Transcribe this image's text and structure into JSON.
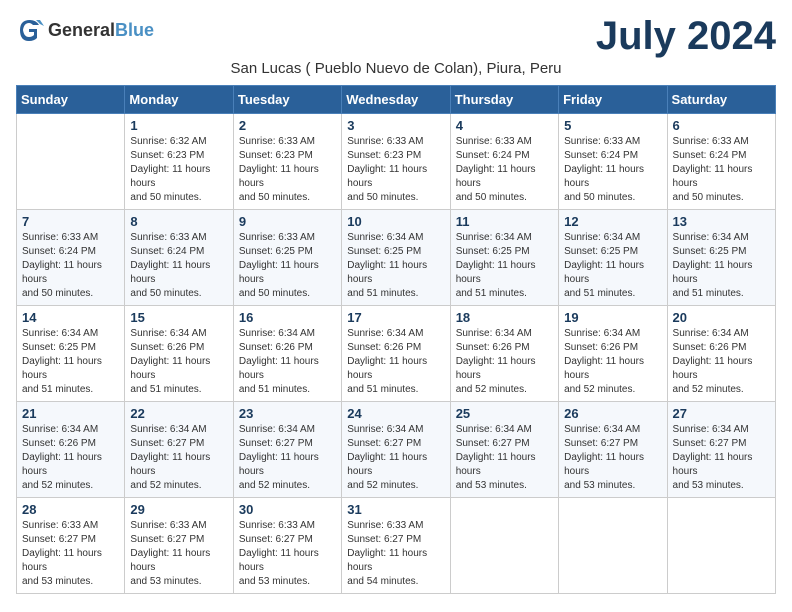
{
  "header": {
    "logo_general": "General",
    "logo_blue": "Blue",
    "month": "July 2024",
    "subtitle": "San Lucas ( Pueblo Nuevo de Colan), Piura, Peru"
  },
  "weekdays": [
    "Sunday",
    "Monday",
    "Tuesday",
    "Wednesday",
    "Thursday",
    "Friday",
    "Saturday"
  ],
  "weeks": [
    [
      {
        "day": "",
        "sunrise": "",
        "sunset": "",
        "daylight": ""
      },
      {
        "day": "1",
        "sunrise": "Sunrise: 6:32 AM",
        "sunset": "Sunset: 6:23 PM",
        "daylight": "Daylight: 11 hours and 50 minutes."
      },
      {
        "day": "2",
        "sunrise": "Sunrise: 6:33 AM",
        "sunset": "Sunset: 6:23 PM",
        "daylight": "Daylight: 11 hours and 50 minutes."
      },
      {
        "day": "3",
        "sunrise": "Sunrise: 6:33 AM",
        "sunset": "Sunset: 6:23 PM",
        "daylight": "Daylight: 11 hours and 50 minutes."
      },
      {
        "day": "4",
        "sunrise": "Sunrise: 6:33 AM",
        "sunset": "Sunset: 6:24 PM",
        "daylight": "Daylight: 11 hours and 50 minutes."
      },
      {
        "day": "5",
        "sunrise": "Sunrise: 6:33 AM",
        "sunset": "Sunset: 6:24 PM",
        "daylight": "Daylight: 11 hours and 50 minutes."
      },
      {
        "day": "6",
        "sunrise": "Sunrise: 6:33 AM",
        "sunset": "Sunset: 6:24 PM",
        "daylight": "Daylight: 11 hours and 50 minutes."
      }
    ],
    [
      {
        "day": "7",
        "sunrise": "Sunrise: 6:33 AM",
        "sunset": "Sunset: 6:24 PM",
        "daylight": "Daylight: 11 hours and 50 minutes."
      },
      {
        "day": "8",
        "sunrise": "Sunrise: 6:33 AM",
        "sunset": "Sunset: 6:24 PM",
        "daylight": "Daylight: 11 hours and 50 minutes."
      },
      {
        "day": "9",
        "sunrise": "Sunrise: 6:33 AM",
        "sunset": "Sunset: 6:25 PM",
        "daylight": "Daylight: 11 hours and 50 minutes."
      },
      {
        "day": "10",
        "sunrise": "Sunrise: 6:34 AM",
        "sunset": "Sunset: 6:25 PM",
        "daylight": "Daylight: 11 hours and 51 minutes."
      },
      {
        "day": "11",
        "sunrise": "Sunrise: 6:34 AM",
        "sunset": "Sunset: 6:25 PM",
        "daylight": "Daylight: 11 hours and 51 minutes."
      },
      {
        "day": "12",
        "sunrise": "Sunrise: 6:34 AM",
        "sunset": "Sunset: 6:25 PM",
        "daylight": "Daylight: 11 hours and 51 minutes."
      },
      {
        "day": "13",
        "sunrise": "Sunrise: 6:34 AM",
        "sunset": "Sunset: 6:25 PM",
        "daylight": "Daylight: 11 hours and 51 minutes."
      }
    ],
    [
      {
        "day": "14",
        "sunrise": "Sunrise: 6:34 AM",
        "sunset": "Sunset: 6:25 PM",
        "daylight": "Daylight: 11 hours and 51 minutes."
      },
      {
        "day": "15",
        "sunrise": "Sunrise: 6:34 AM",
        "sunset": "Sunset: 6:26 PM",
        "daylight": "Daylight: 11 hours and 51 minutes."
      },
      {
        "day": "16",
        "sunrise": "Sunrise: 6:34 AM",
        "sunset": "Sunset: 6:26 PM",
        "daylight": "Daylight: 11 hours and 51 minutes."
      },
      {
        "day": "17",
        "sunrise": "Sunrise: 6:34 AM",
        "sunset": "Sunset: 6:26 PM",
        "daylight": "Daylight: 11 hours and 51 minutes."
      },
      {
        "day": "18",
        "sunrise": "Sunrise: 6:34 AM",
        "sunset": "Sunset: 6:26 PM",
        "daylight": "Daylight: 11 hours and 52 minutes."
      },
      {
        "day": "19",
        "sunrise": "Sunrise: 6:34 AM",
        "sunset": "Sunset: 6:26 PM",
        "daylight": "Daylight: 11 hours and 52 minutes."
      },
      {
        "day": "20",
        "sunrise": "Sunrise: 6:34 AM",
        "sunset": "Sunset: 6:26 PM",
        "daylight": "Daylight: 11 hours and 52 minutes."
      }
    ],
    [
      {
        "day": "21",
        "sunrise": "Sunrise: 6:34 AM",
        "sunset": "Sunset: 6:26 PM",
        "daylight": "Daylight: 11 hours and 52 minutes."
      },
      {
        "day": "22",
        "sunrise": "Sunrise: 6:34 AM",
        "sunset": "Sunset: 6:27 PM",
        "daylight": "Daylight: 11 hours and 52 minutes."
      },
      {
        "day": "23",
        "sunrise": "Sunrise: 6:34 AM",
        "sunset": "Sunset: 6:27 PM",
        "daylight": "Daylight: 11 hours and 52 minutes."
      },
      {
        "day": "24",
        "sunrise": "Sunrise: 6:34 AM",
        "sunset": "Sunset: 6:27 PM",
        "daylight": "Daylight: 11 hours and 52 minutes."
      },
      {
        "day": "25",
        "sunrise": "Sunrise: 6:34 AM",
        "sunset": "Sunset: 6:27 PM",
        "daylight": "Daylight: 11 hours and 53 minutes."
      },
      {
        "day": "26",
        "sunrise": "Sunrise: 6:34 AM",
        "sunset": "Sunset: 6:27 PM",
        "daylight": "Daylight: 11 hours and 53 minutes."
      },
      {
        "day": "27",
        "sunrise": "Sunrise: 6:34 AM",
        "sunset": "Sunset: 6:27 PM",
        "daylight": "Daylight: 11 hours and 53 minutes."
      }
    ],
    [
      {
        "day": "28",
        "sunrise": "Sunrise: 6:33 AM",
        "sunset": "Sunset: 6:27 PM",
        "daylight": "Daylight: 11 hours and 53 minutes."
      },
      {
        "day": "29",
        "sunrise": "Sunrise: 6:33 AM",
        "sunset": "Sunset: 6:27 PM",
        "daylight": "Daylight: 11 hours and 53 minutes."
      },
      {
        "day": "30",
        "sunrise": "Sunrise: 6:33 AM",
        "sunset": "Sunset: 6:27 PM",
        "daylight": "Daylight: 11 hours and 53 minutes."
      },
      {
        "day": "31",
        "sunrise": "Sunrise: 6:33 AM",
        "sunset": "Sunset: 6:27 PM",
        "daylight": "Daylight: 11 hours and 54 minutes."
      },
      {
        "day": "",
        "sunrise": "",
        "sunset": "",
        "daylight": ""
      },
      {
        "day": "",
        "sunrise": "",
        "sunset": "",
        "daylight": ""
      },
      {
        "day": "",
        "sunrise": "",
        "sunset": "",
        "daylight": ""
      }
    ]
  ]
}
